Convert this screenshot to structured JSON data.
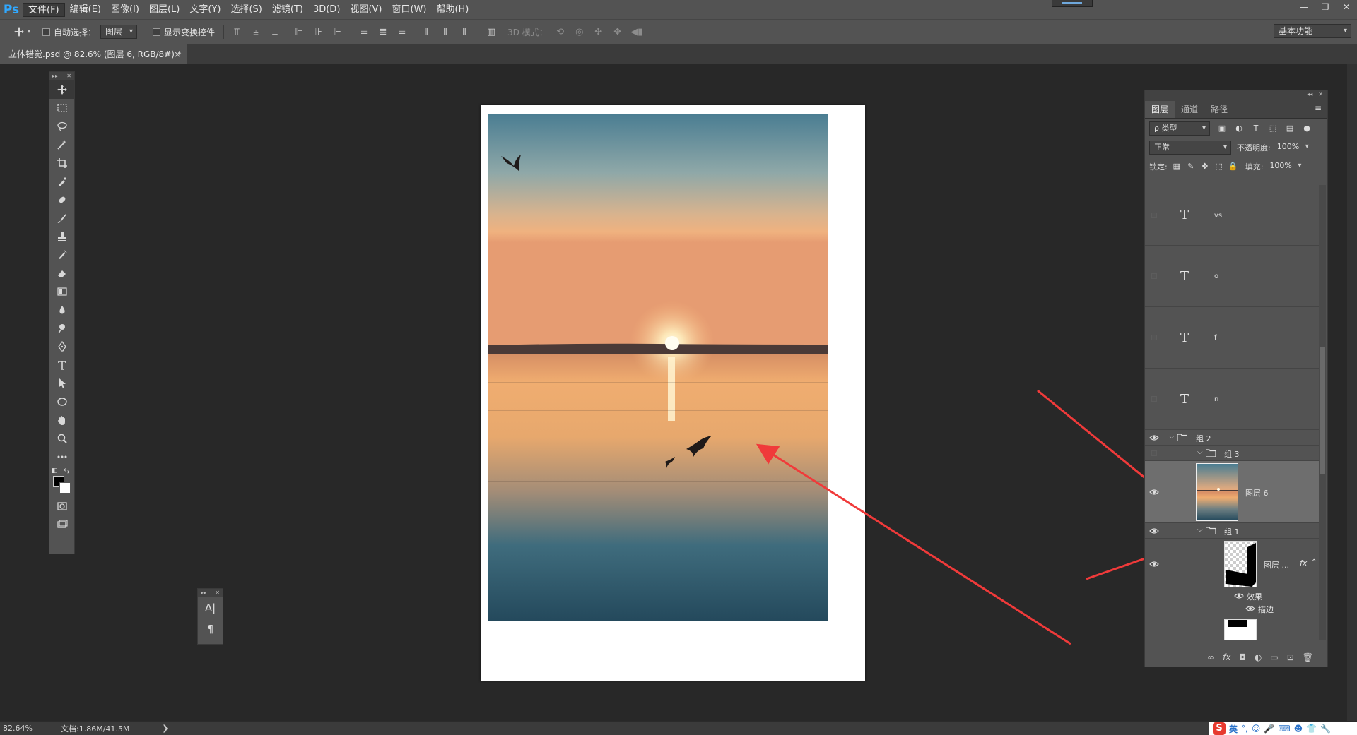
{
  "app": {
    "logo": "Ps",
    "colors": {
      "menu_bg": "#535353",
      "canvas_bg": "#282828",
      "accent": "#31a8ff",
      "arrow": "#f03a3a"
    }
  },
  "menu": [
    "文件(F)",
    "编辑(E)",
    "图像(I)",
    "图层(L)",
    "文字(Y)",
    "选择(S)",
    "滤镜(T)",
    "3D(D)",
    "视图(V)",
    "窗口(W)",
    "帮助(H)"
  ],
  "window_controls": [
    "—",
    "❐",
    "✕"
  ],
  "options": {
    "auto_select_label": "自动选择：",
    "auto_select_value": "图层",
    "show_transform_label": "显示变换控件",
    "mode_3d_label": "3D 模式：",
    "workspace": "基本功能"
  },
  "document_tab": {
    "title": "立体错觉.psd @ 82.6% (图层 6, RGB/8#) *",
    "close": "×"
  },
  "tools": [
    {
      "name": "move-tool",
      "icon": "move-icon"
    },
    {
      "name": "marquee-tool",
      "icon": "marquee-icon"
    },
    {
      "name": "lasso-tool",
      "icon": "lasso-icon"
    },
    {
      "name": "magic-wand-tool",
      "icon": "magic-wand-icon"
    },
    {
      "name": "crop-tool",
      "icon": "crop-icon"
    },
    {
      "name": "eyedropper-tool",
      "icon": "eyedropper-icon"
    },
    {
      "name": "healing-tool",
      "icon": "bandage-icon"
    },
    {
      "name": "brush-tool",
      "icon": "brush-icon"
    },
    {
      "name": "stamp-tool",
      "icon": "stamp-icon"
    },
    {
      "name": "history-brush-tool",
      "icon": "history-brush-icon"
    },
    {
      "name": "eraser-tool",
      "icon": "eraser-icon"
    },
    {
      "name": "gradient-tool",
      "icon": "gradient-icon"
    },
    {
      "name": "blur-tool",
      "icon": "blur-icon"
    },
    {
      "name": "dodge-tool",
      "icon": "dodge-icon"
    },
    {
      "name": "pen-tool",
      "icon": "pen-icon"
    },
    {
      "name": "type-tool",
      "icon": "type-icon"
    },
    {
      "name": "path-select-tool",
      "icon": "arrow-select-icon"
    },
    {
      "name": "shape-tool",
      "icon": "ellipse-icon"
    },
    {
      "name": "hand-tool",
      "icon": "hand-icon"
    },
    {
      "name": "zoom-tool",
      "icon": "zoom-icon"
    },
    {
      "name": "more-tools",
      "icon": "ellipsis-icon"
    }
  ],
  "char_panel": {
    "char_label": "A|",
    "para_label": "¶"
  },
  "layers_panel": {
    "tabs": [
      "图层",
      "通道",
      "路径"
    ],
    "filter_label": "ρ 类型",
    "blend_mode": "正常",
    "opacity_label": "不透明度:",
    "opacity_value": "100%",
    "lock_label": "锁定:",
    "fill_label": "填充:",
    "fill_value": "100%",
    "text_layers": [
      "vs",
      "o",
      "f",
      "n"
    ],
    "group2": "组 2",
    "group3": "组 3",
    "layer6": "图层 6",
    "group1": "组 1",
    "layer_trunc": "图层 ...",
    "fx_label": "fx",
    "effects_label": "效果",
    "stroke_label": "描边",
    "bottom_icons": [
      "∞",
      "fx",
      "◘",
      "◐",
      "▭",
      "⊡",
      "🗑"
    ]
  },
  "status": {
    "zoom": "82.64%",
    "doc_info": "文档:1.86M/41.5M",
    "arrow": "❯",
    "ime_logo": "S",
    "ime_lang": "英"
  }
}
